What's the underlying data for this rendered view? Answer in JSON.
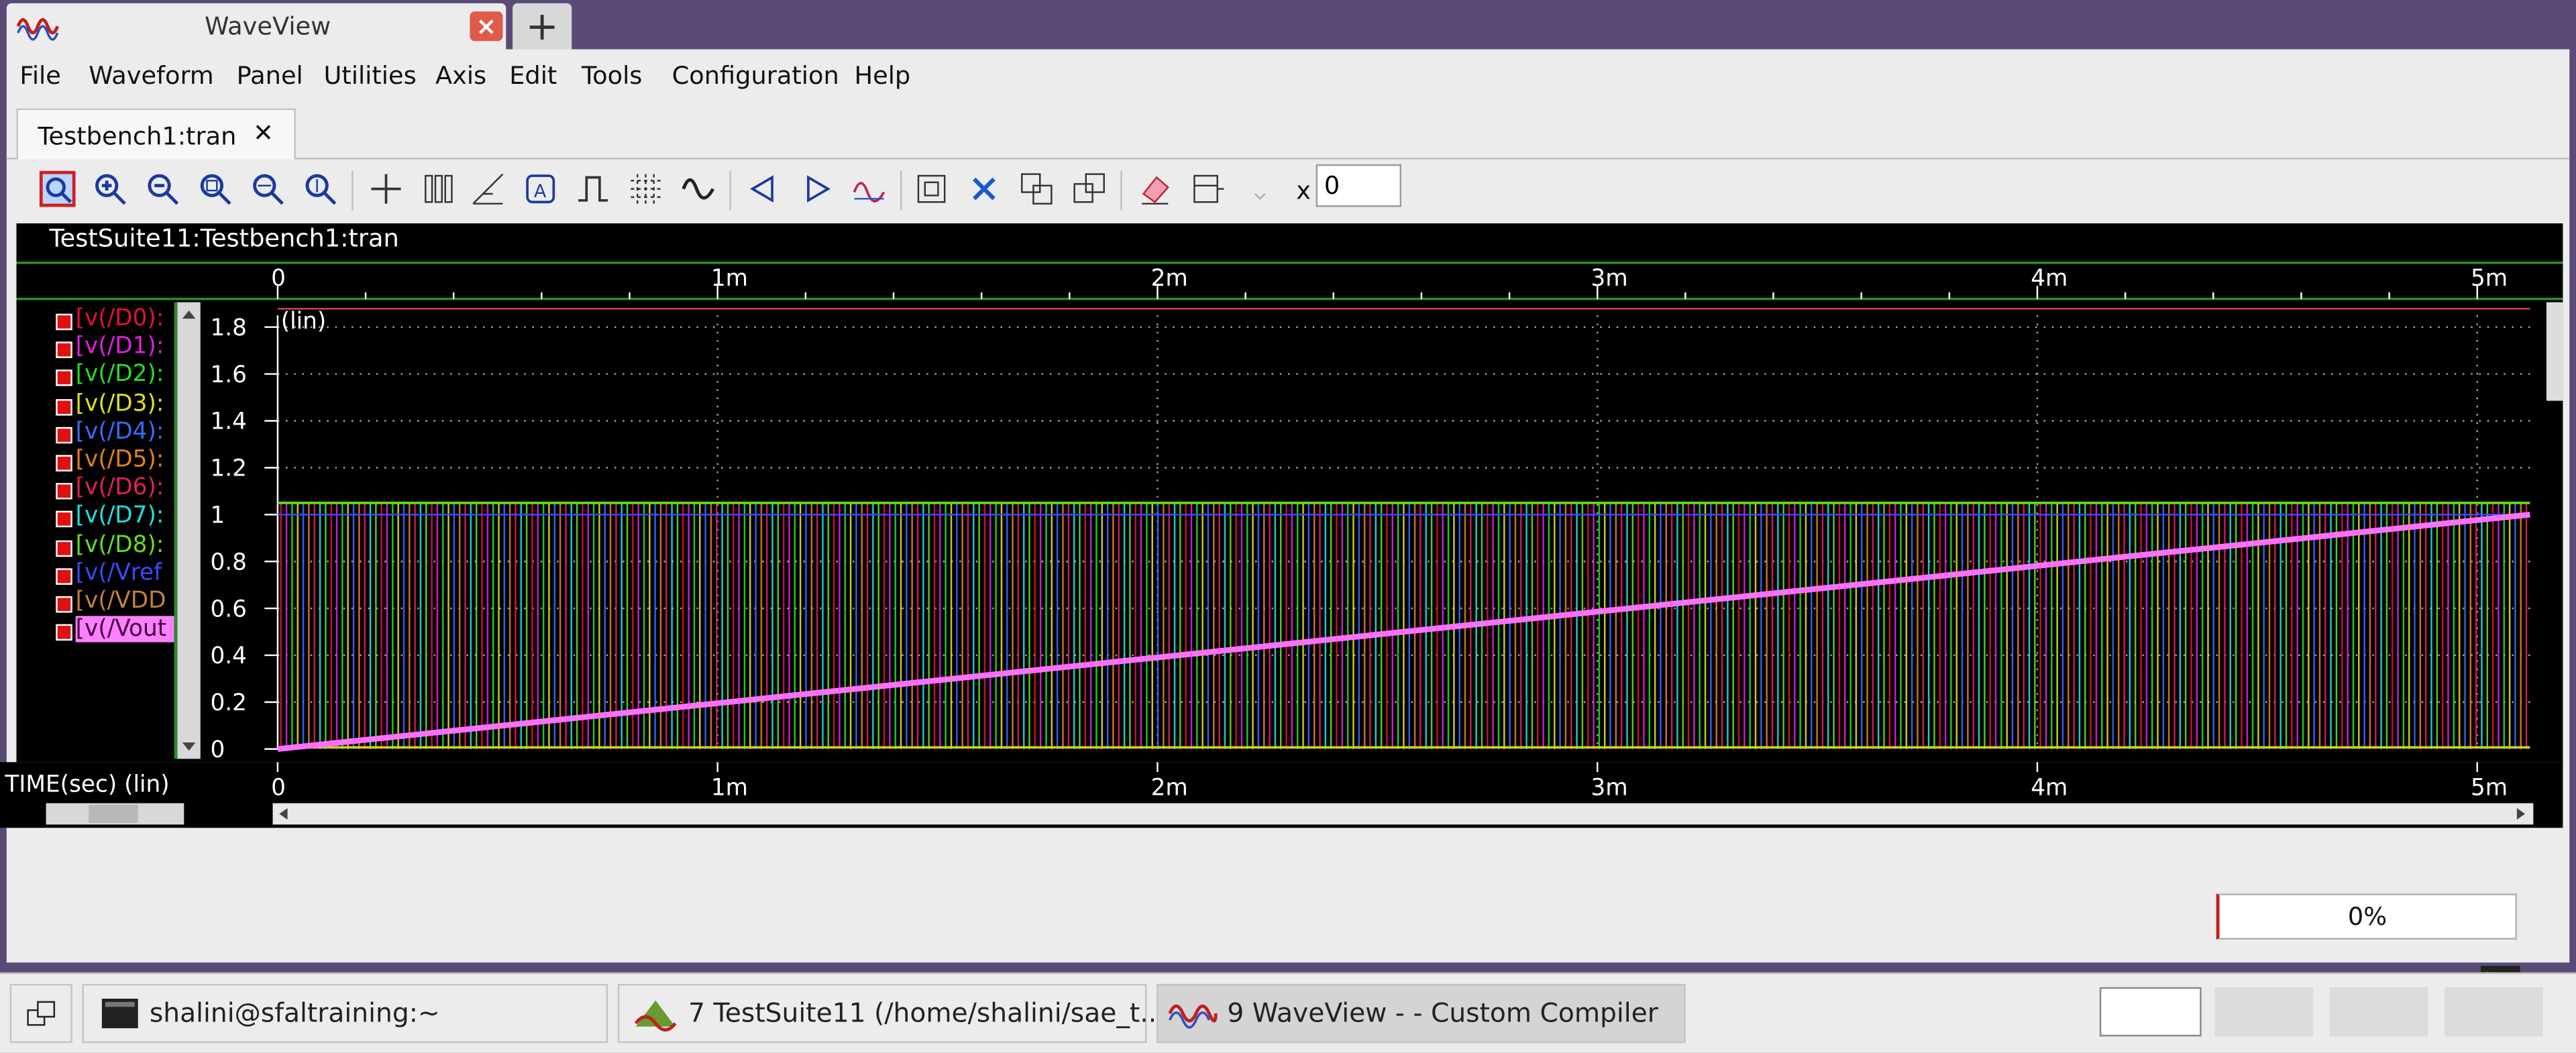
{
  "window": {
    "title": "WaveView",
    "new_tab_label": "+"
  },
  "menus": [
    "File",
    "Waveform",
    "Panel",
    "Utilities",
    "Axis",
    "Edit",
    "Tools",
    "Configuration",
    "Help"
  ],
  "doc_tab": {
    "label": "Testbench1:tran",
    "close": "✕"
  },
  "toolbar": {
    "x_label": "x",
    "x_value": "0"
  },
  "panel": {
    "title": "TestSuite11:Testbench1:tran",
    "y_scale_label": "(lin)",
    "x_axis_label": "TIME(sec) (lin)"
  },
  "signals": [
    {
      "label": "[v(/D0):",
      "color": "#e0103a"
    },
    {
      "label": "[v(/D1):",
      "color": "#e020e0"
    },
    {
      "label": "[v(/D2):",
      "color": "#20e020"
    },
    {
      "label": "[v(/D3):",
      "color": "#e0e020"
    },
    {
      "label": "[v(/D4):",
      "color": "#3a6aff"
    },
    {
      "label": "[v(/D5):",
      "color": "#e08020"
    },
    {
      "label": "[v(/D6):",
      "color": "#e0205a"
    },
    {
      "label": "[v(/D7):",
      "color": "#20e0e0"
    },
    {
      "label": "[v(/D8):",
      "color": "#60e020"
    },
    {
      "label": "[v(/Vref",
      "color": "#3a4aff"
    },
    {
      "label": "[v(/VDD",
      "color": "#c08040"
    },
    {
      "label": "[v(/Vout",
      "color": "#ff60ff"
    }
  ],
  "chart_data": {
    "type": "line",
    "x_ticks": [
      "0",
      "1m",
      "2m",
      "3m",
      "4m",
      "5m"
    ],
    "y_ticks": [
      "1.8",
      "1.6",
      "1.4",
      "1.2",
      "1",
      "0.8",
      "0.6",
      "0.4",
      "0.2",
      "0"
    ],
    "xlim": [
      0,
      0.00512
    ],
    "ylim": [
      0,
      1.85
    ],
    "grid": true,
    "series": [
      {
        "name": "v(/Vout",
        "x": [
          0,
          0.00512
        ],
        "y": [
          0,
          1.0
        ]
      },
      {
        "name": "v(/VDD",
        "x": [
          0,
          0.00512
        ],
        "y": [
          1.05,
          1.05
        ]
      }
    ]
  },
  "status": {
    "progress": "0%"
  },
  "taskbar": {
    "items": [
      "shalini@sfaltraining:~",
      "7 TestSuite11 (/home/shalini/sae_t...",
      "9 WaveView -  - Custom Compiler"
    ]
  }
}
